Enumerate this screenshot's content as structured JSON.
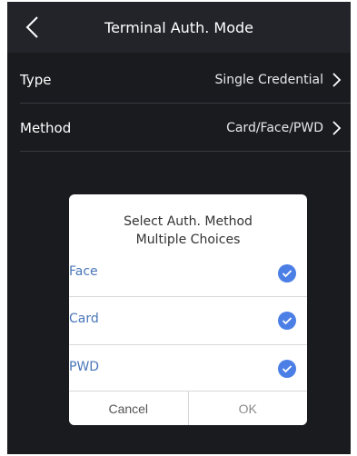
{
  "header": {
    "title": "Terminal Auth. Mode",
    "back_icon": "chevron-left-icon"
  },
  "settings": [
    {
      "label": "Type",
      "value": "Single Credential"
    },
    {
      "label": "Method",
      "value": "Card/Face/PWD"
    }
  ],
  "dialog": {
    "title_line1": "Select Auth. Method",
    "title_line2": "Multiple Choices",
    "options": [
      {
        "label": "Face",
        "checked": true
      },
      {
        "label": "Card",
        "checked": true
      },
      {
        "label": "PWD",
        "checked": true
      }
    ],
    "cancel_label": "Cancel",
    "ok_label": "OK"
  },
  "colors": {
    "background": "#1a1b1f",
    "header": "#23242a",
    "check": "#4c7fe6",
    "option_text": "#4a76b8"
  }
}
